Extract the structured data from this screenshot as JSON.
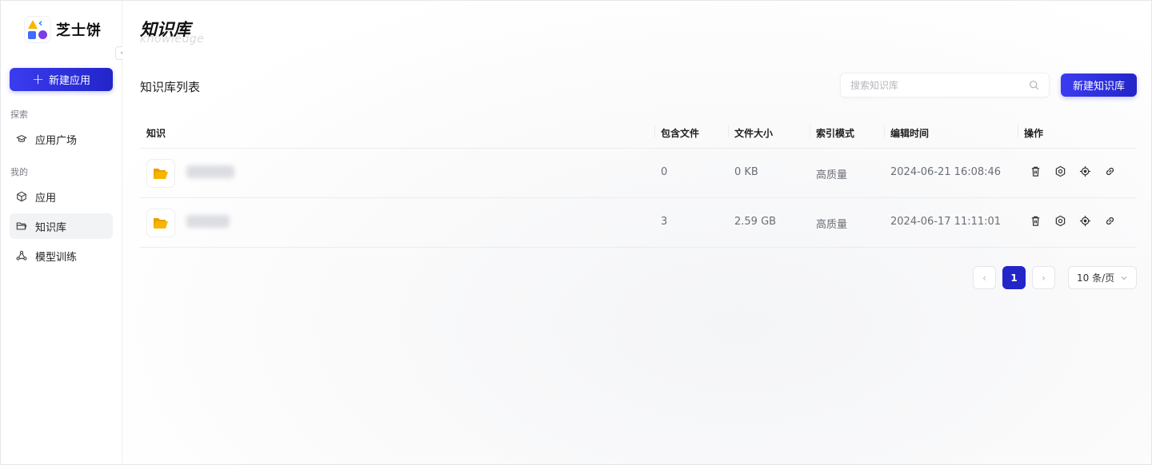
{
  "brand": {
    "name": "芝士饼"
  },
  "sidebar": {
    "new_app_label": "新建应用",
    "sections": [
      {
        "label": "探索",
        "items": [
          {
            "label": "应用广场",
            "icon": "grad-cap-icon"
          }
        ]
      },
      {
        "label": "我的",
        "items": [
          {
            "label": "应用",
            "icon": "cube-icon"
          },
          {
            "label": "知识库",
            "icon": "folder-icon",
            "active": true
          },
          {
            "label": "模型训练",
            "icon": "network-icon"
          }
        ]
      }
    ]
  },
  "header": {
    "title": "知识库",
    "subtitle": "knowledge"
  },
  "list": {
    "title": "知识库列表",
    "search_placeholder": "搜索知识库",
    "new_button": "新建知识库"
  },
  "table": {
    "columns": [
      "知识",
      "包含文件",
      "文件大小",
      "索引模式",
      "编辑时间",
      "操作"
    ],
    "rows": [
      {
        "files": "0",
        "size": "0 KB",
        "index": "高质量",
        "edited": "2024-06-21 16:08:46"
      },
      {
        "files": "3",
        "size": "2.59 GB",
        "index": "高质量",
        "edited": "2024-06-17 11:11:01"
      }
    ]
  },
  "pagination": {
    "current": "1",
    "page_size": "10 条/页"
  },
  "colors": {
    "accent": "#2325c9",
    "folder": "#f7b500"
  }
}
